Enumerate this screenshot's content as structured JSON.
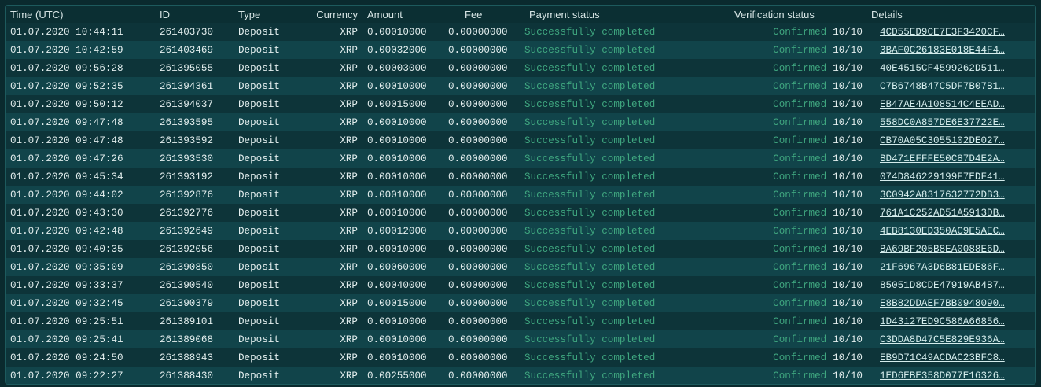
{
  "columns": {
    "time": "Time (UTC)",
    "id": "ID",
    "type": "Type",
    "currency": "Currency",
    "amount": "Amount",
    "fee": "Fee",
    "payment_status": "Payment status",
    "verification_status": "Verification status",
    "details": "Details"
  },
  "rows": [
    {
      "time": "01.07.2020 10:44:11",
      "id": "261403730",
      "type": "Deposit",
      "currency": "XRP",
      "amount": "0.00010000",
      "fee": "0.00000000",
      "payment_status": "Successfully completed",
      "verification": "Confirmed",
      "confirmations": "10/10",
      "details": "4CD55ED9CE7E3F3420CF…"
    },
    {
      "time": "01.07.2020 10:42:59",
      "id": "261403469",
      "type": "Deposit",
      "currency": "XRP",
      "amount": "0.00032000",
      "fee": "0.00000000",
      "payment_status": "Successfully completed",
      "verification": "Confirmed",
      "confirmations": "10/10",
      "details": "3BAF0C26183E018E44F4…"
    },
    {
      "time": "01.07.2020 09:56:28",
      "id": "261395055",
      "type": "Deposit",
      "currency": "XRP",
      "amount": "0.00003000",
      "fee": "0.00000000",
      "payment_status": "Successfully completed",
      "verification": "Confirmed",
      "confirmations": "10/10",
      "details": "40E4515CF4599262D511…"
    },
    {
      "time": "01.07.2020 09:52:35",
      "id": "261394361",
      "type": "Deposit",
      "currency": "XRP",
      "amount": "0.00010000",
      "fee": "0.00000000",
      "payment_status": "Successfully completed",
      "verification": "Confirmed",
      "confirmations": "10/10",
      "details": "C7B6748B47C5DF7B07B1…"
    },
    {
      "time": "01.07.2020 09:50:12",
      "id": "261394037",
      "type": "Deposit",
      "currency": "XRP",
      "amount": "0.00015000",
      "fee": "0.00000000",
      "payment_status": "Successfully completed",
      "verification": "Confirmed",
      "confirmations": "10/10",
      "details": "EB47AE4A108514C4EEAD…"
    },
    {
      "time": "01.07.2020 09:47:48",
      "id": "261393595",
      "type": "Deposit",
      "currency": "XRP",
      "amount": "0.00010000",
      "fee": "0.00000000",
      "payment_status": "Successfully completed",
      "verification": "Confirmed",
      "confirmations": "10/10",
      "details": "558DC0A857DE6E37722E…"
    },
    {
      "time": "01.07.2020 09:47:48",
      "id": "261393592",
      "type": "Deposit",
      "currency": "XRP",
      "amount": "0.00010000",
      "fee": "0.00000000",
      "payment_status": "Successfully completed",
      "verification": "Confirmed",
      "confirmations": "10/10",
      "details": "CB70A05C3055102DE027…"
    },
    {
      "time": "01.07.2020 09:47:26",
      "id": "261393530",
      "type": "Deposit",
      "currency": "XRP",
      "amount": "0.00010000",
      "fee": "0.00000000",
      "payment_status": "Successfully completed",
      "verification": "Confirmed",
      "confirmations": "10/10",
      "details": "BD471EFFFE50C87D4E2A…"
    },
    {
      "time": "01.07.2020 09:45:34",
      "id": "261393192",
      "type": "Deposit",
      "currency": "XRP",
      "amount": "0.00010000",
      "fee": "0.00000000",
      "payment_status": "Successfully completed",
      "verification": "Confirmed",
      "confirmations": "10/10",
      "details": "074D846229199F7EDF41…"
    },
    {
      "time": "01.07.2020 09:44:02",
      "id": "261392876",
      "type": "Deposit",
      "currency": "XRP",
      "amount": "0.00010000",
      "fee": "0.00000000",
      "payment_status": "Successfully completed",
      "verification": "Confirmed",
      "confirmations": "10/10",
      "details": "3C0942A8317632772DB3…"
    },
    {
      "time": "01.07.2020 09:43:30",
      "id": "261392776",
      "type": "Deposit",
      "currency": "XRP",
      "amount": "0.00010000",
      "fee": "0.00000000",
      "payment_status": "Successfully completed",
      "verification": "Confirmed",
      "confirmations": "10/10",
      "details": "761A1C252AD51A5913DB…"
    },
    {
      "time": "01.07.2020 09:42:48",
      "id": "261392649",
      "type": "Deposit",
      "currency": "XRP",
      "amount": "0.00012000",
      "fee": "0.00000000",
      "payment_status": "Successfully completed",
      "verification": "Confirmed",
      "confirmations": "10/10",
      "details": "4EB8130ED350AC9E5AEC…"
    },
    {
      "time": "01.07.2020 09:40:35",
      "id": "261392056",
      "type": "Deposit",
      "currency": "XRP",
      "amount": "0.00010000",
      "fee": "0.00000000",
      "payment_status": "Successfully completed",
      "verification": "Confirmed",
      "confirmations": "10/10",
      "details": "BA69BF205B8EA0088E6D…"
    },
    {
      "time": "01.07.2020 09:35:09",
      "id": "261390850",
      "type": "Deposit",
      "currency": "XRP",
      "amount": "0.00060000",
      "fee": "0.00000000",
      "payment_status": "Successfully completed",
      "verification": "Confirmed",
      "confirmations": "10/10",
      "details": "21F6967A3D6B81EDE86F…"
    },
    {
      "time": "01.07.2020 09:33:37",
      "id": "261390540",
      "type": "Deposit",
      "currency": "XRP",
      "amount": "0.00040000",
      "fee": "0.00000000",
      "payment_status": "Successfully completed",
      "verification": "Confirmed",
      "confirmations": "10/10",
      "details": "85051D8CDE47919AB4B7…"
    },
    {
      "time": "01.07.2020 09:32:45",
      "id": "261390379",
      "type": "Deposit",
      "currency": "XRP",
      "amount": "0.00015000",
      "fee": "0.00000000",
      "payment_status": "Successfully completed",
      "verification": "Confirmed",
      "confirmations": "10/10",
      "details": "E8B82DDAEF7BB0948090…"
    },
    {
      "time": "01.07.2020 09:25:51",
      "id": "261389101",
      "type": "Deposit",
      "currency": "XRP",
      "amount": "0.00010000",
      "fee": "0.00000000",
      "payment_status": "Successfully completed",
      "verification": "Confirmed",
      "confirmations": "10/10",
      "details": "1D43127ED9C586A66856…"
    },
    {
      "time": "01.07.2020 09:25:41",
      "id": "261389068",
      "type": "Deposit",
      "currency": "XRP",
      "amount": "0.00010000",
      "fee": "0.00000000",
      "payment_status": "Successfully completed",
      "verification": "Confirmed",
      "confirmations": "10/10",
      "details": "C3DDA8D47C5E829E936A…"
    },
    {
      "time": "01.07.2020 09:24:50",
      "id": "261388943",
      "type": "Deposit",
      "currency": "XRP",
      "amount": "0.00010000",
      "fee": "0.00000000",
      "payment_status": "Successfully completed",
      "verification": "Confirmed",
      "confirmations": "10/10",
      "details": "EB9D71C49ACDAC23BFC8…"
    },
    {
      "time": "01.07.2020 09:22:27",
      "id": "261388430",
      "type": "Deposit",
      "currency": "XRP",
      "amount": "0.00255000",
      "fee": "0.00000000",
      "payment_status": "Successfully completed",
      "verification": "Confirmed",
      "confirmations": "10/10",
      "details": "1ED6EBE358D077E16326…"
    }
  ],
  "colors": {
    "background": "#0a2a2e",
    "row_odd": "#0d3439",
    "row_even": "#11444a",
    "success_green": "#3fa67f",
    "text": "#e3eeee"
  }
}
